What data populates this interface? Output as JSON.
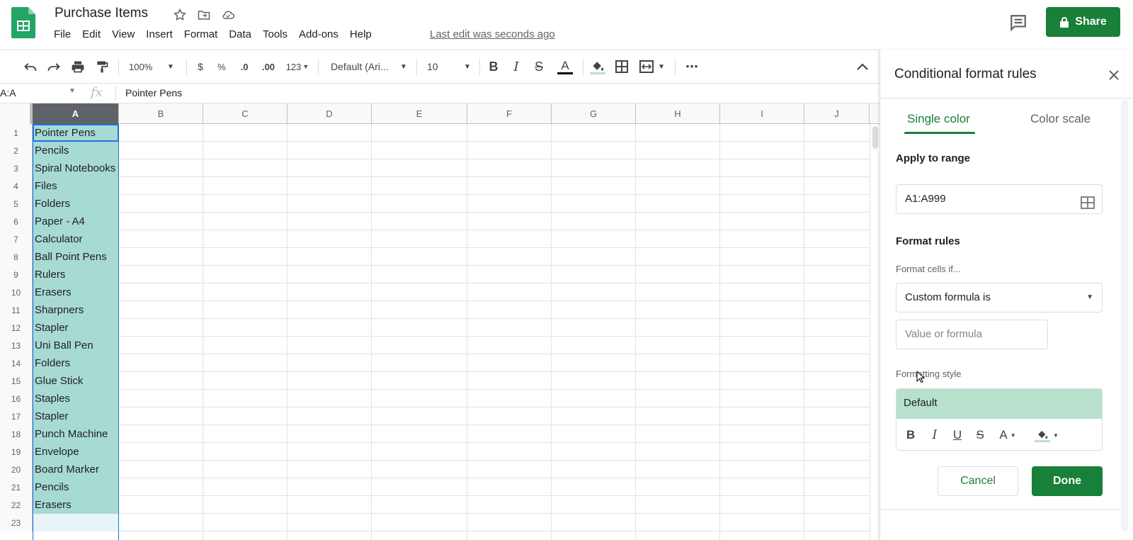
{
  "app": {
    "doc_title": "Purchase Items",
    "menu": [
      "File",
      "Edit",
      "View",
      "Insert",
      "Format",
      "Data",
      "Tools",
      "Add-ons",
      "Help"
    ],
    "last_edit": "Last edit was seconds ago",
    "share_label": "Share",
    "brand_color": "#188038"
  },
  "toolbar": {
    "zoom": "100%",
    "currency": "$",
    "percent": "%",
    "decrease_decimals": ".0",
    "increase_decimals": ".00",
    "more_formats": "123",
    "font_family": "Default (Ari...",
    "font_size": "10"
  },
  "formula_bar": {
    "name_box": "A:A",
    "fx": "fx",
    "value": "Pointer Pens"
  },
  "grid": {
    "columns": [
      "A",
      "B",
      "C",
      "D",
      "E",
      "F",
      "G",
      "H",
      "I",
      "J"
    ],
    "selected_column": "A",
    "rows": [
      {
        "num": "1",
        "a": "Pointer Pens"
      },
      {
        "num": "2",
        "a": "Pencils"
      },
      {
        "num": "3",
        "a": "Spiral Notebooks"
      },
      {
        "num": "4",
        "a": "Files"
      },
      {
        "num": "5",
        "a": "Folders"
      },
      {
        "num": "6",
        "a": "Paper - A4"
      },
      {
        "num": "7",
        "a": "Calculator"
      },
      {
        "num": "8",
        "a": "Ball Point Pens"
      },
      {
        "num": "9",
        "a": "Rulers"
      },
      {
        "num": "10",
        "a": "Erasers"
      },
      {
        "num": "11",
        "a": "Sharpners"
      },
      {
        "num": "12",
        "a": "Stapler"
      },
      {
        "num": "13",
        "a": "Uni Ball Pen"
      },
      {
        "num": "14",
        "a": "Folders"
      },
      {
        "num": "15",
        "a": "Glue Stick"
      },
      {
        "num": "16",
        "a": "Staples"
      },
      {
        "num": "17",
        "a": "Stapler"
      },
      {
        "num": "18",
        "a": "Punch Machine"
      },
      {
        "num": "19",
        "a": "Envelope"
      },
      {
        "num": "20",
        "a": "Board Marker"
      },
      {
        "num": "21",
        "a": "Pencils"
      },
      {
        "num": "22",
        "a": "Erasers"
      },
      {
        "num": "23",
        "a": ""
      }
    ],
    "selection_color": "#a8dad4"
  },
  "panel": {
    "title": "Conditional format rules",
    "tab_single": "Single color",
    "tab_scale": "Color scale",
    "apply_label": "Apply to range",
    "range_value": "A1:A999",
    "rules_label": "Format rules",
    "cells_if_label": "Format cells if...",
    "condition": "Custom formula is",
    "value_placeholder": "Value or formula",
    "style_label": "Formatting style",
    "style_preview": "Default",
    "style_preview_color": "#b7e1cd",
    "cancel": "Cancel",
    "done": "Done"
  }
}
